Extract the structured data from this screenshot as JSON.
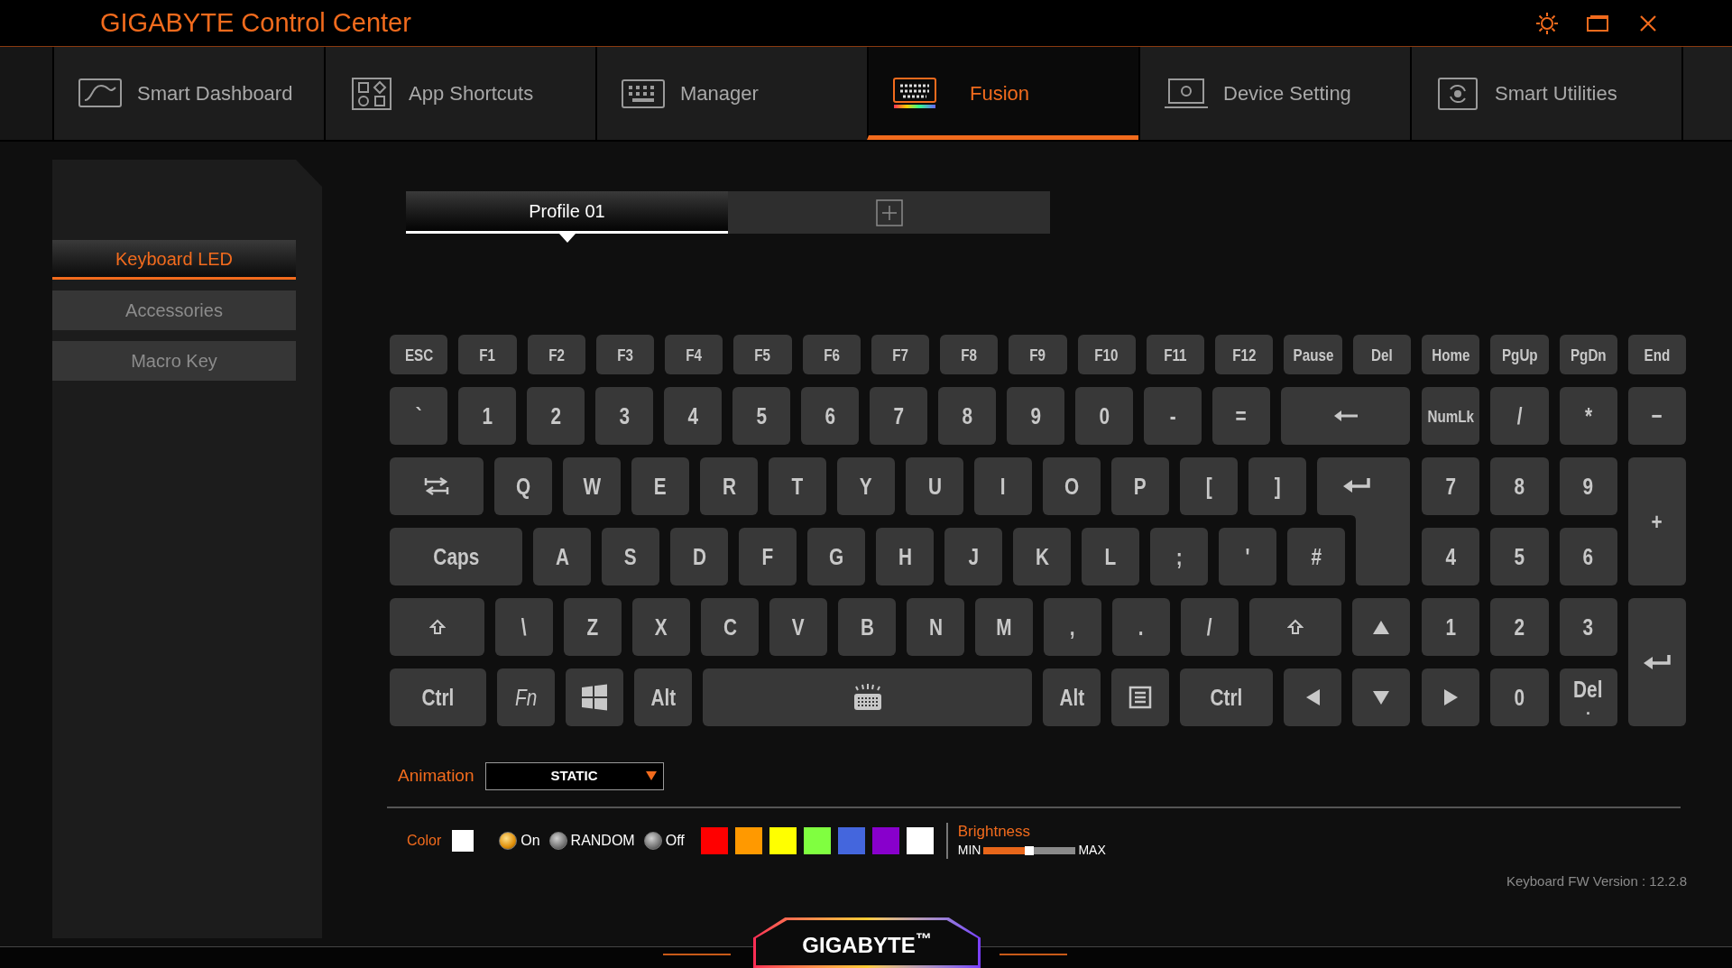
{
  "window": {
    "title": "GIGABYTE Control Center"
  },
  "tabs": [
    {
      "label": "Smart Dashboard",
      "selected": false
    },
    {
      "label": "App Shortcuts",
      "selected": false
    },
    {
      "label": "Manager",
      "selected": false
    },
    {
      "label": "Fusion",
      "selected": true
    },
    {
      "label": "Device Setting",
      "selected": false
    },
    {
      "label": "Smart Utilities",
      "selected": false
    }
  ],
  "sidebar": {
    "items": [
      {
        "label": "Keyboard LED",
        "selected": true
      },
      {
        "label": "Accessories",
        "selected": false
      },
      {
        "label": "Macro Key",
        "selected": false
      }
    ]
  },
  "profiles": [
    {
      "label": "Profile 01",
      "selected": true
    }
  ],
  "keyboard": {
    "function_row": [
      {
        "label": "ESC"
      },
      {
        "label": "F1"
      },
      {
        "label": "F2"
      },
      {
        "label": "F3"
      },
      {
        "label": "F4"
      },
      {
        "label": "F5"
      },
      {
        "label": "F6"
      },
      {
        "label": "F7"
      },
      {
        "label": "F8"
      },
      {
        "label": "F9"
      },
      {
        "label": "F10"
      },
      {
        "label": "F11"
      },
      {
        "label": "F12"
      },
      {
        "label": "Pause"
      },
      {
        "label": "Del"
      },
      {
        "label": "Home"
      },
      {
        "label": "PgUp"
      },
      {
        "label": "PgDn"
      },
      {
        "label": "End"
      }
    ],
    "main_rows": [
      [
        {
          "label": "`"
        },
        {
          "label": "1"
        },
        {
          "label": "2"
        },
        {
          "label": "3"
        },
        {
          "label": "4"
        },
        {
          "label": "5"
        },
        {
          "label": "6"
        },
        {
          "label": "7"
        },
        {
          "label": "8"
        },
        {
          "label": "9"
        },
        {
          "label": "0"
        },
        {
          "label": "-"
        },
        {
          "label": "="
        },
        {
          "kind": "backspace"
        }
      ],
      [
        {
          "kind": "tab"
        },
        {
          "label": "Q"
        },
        {
          "label": "W"
        },
        {
          "label": "E"
        },
        {
          "label": "R"
        },
        {
          "label": "T"
        },
        {
          "label": "Y"
        },
        {
          "label": "U"
        },
        {
          "label": "I"
        },
        {
          "label": "O"
        },
        {
          "label": "P"
        },
        {
          "label": "["
        },
        {
          "label": "]"
        },
        {
          "kind": "enter"
        }
      ],
      [
        {
          "label": "Caps"
        },
        {
          "label": "A"
        },
        {
          "label": "S"
        },
        {
          "label": "D"
        },
        {
          "label": "F"
        },
        {
          "label": "G"
        },
        {
          "label": "H"
        },
        {
          "label": "J"
        },
        {
          "label": "K"
        },
        {
          "label": "L"
        },
        {
          "label": ";"
        },
        {
          "label": "'"
        },
        {
          "label": "#"
        }
      ],
      [
        {
          "kind": "shift"
        },
        {
          "label": "\\"
        },
        {
          "label": "Z"
        },
        {
          "label": "X"
        },
        {
          "label": "C"
        },
        {
          "label": "V"
        },
        {
          "label": "B"
        },
        {
          "label": "N"
        },
        {
          "label": "M"
        },
        {
          "label": ","
        },
        {
          "label": "."
        },
        {
          "label": "/"
        },
        {
          "kind": "shift"
        },
        {
          "kind": "up"
        }
      ],
      [
        {
          "label": "Ctrl"
        },
        {
          "label": "Fn",
          "kind": "italic"
        },
        {
          "kind": "windows"
        },
        {
          "label": "Alt"
        },
        {
          "kind": "space"
        },
        {
          "label": "Alt"
        },
        {
          "kind": "menu"
        },
        {
          "label": "Ctrl"
        },
        {
          "kind": "left"
        },
        {
          "kind": "down"
        }
      ]
    ],
    "numpad": [
      {
        "label": "NumLk"
      },
      {
        "label": "/"
      },
      {
        "label": "*"
      },
      {
        "label": "−"
      },
      {
        "label": "7"
      },
      {
        "label": "8"
      },
      {
        "label": "9"
      },
      {
        "label": "+"
      },
      {
        "label": "4"
      },
      {
        "label": "5"
      },
      {
        "label": "6"
      },
      {
        "label": "1"
      },
      {
        "label": "2"
      },
      {
        "label": "3"
      },
      {
        "kind": "enter_tall"
      },
      {
        "kind": "right"
      },
      {
        "label": "0"
      },
      {
        "label": "Del",
        "sublabel": "."
      }
    ]
  },
  "animation": {
    "label": "Animation",
    "value": "STATIC"
  },
  "color": {
    "label": "Color",
    "current": {
      "color": "#ffffff"
    },
    "modes": [
      {
        "label": "On",
        "selected": true
      },
      {
        "label": "RANDOM",
        "selected": false
      },
      {
        "label": "Off",
        "selected": false
      }
    ],
    "swatches": [
      {
        "color": "#ff0000"
      },
      {
        "color": "#ff9900"
      },
      {
        "color": "#ffff00"
      },
      {
        "color": "#80ff40"
      },
      {
        "color": "#4466dd"
      },
      {
        "color": "#8800cc"
      },
      {
        "color": "#ffffff"
      }
    ]
  },
  "brightness": {
    "label": "Brightness",
    "min_label": "MIN",
    "max_label": "MAX",
    "level": 0.5
  },
  "firmware": "Keyboard FW Version : 12.2.8",
  "footer": {
    "logo": "GIGABYTE$^{™}$"
  }
}
